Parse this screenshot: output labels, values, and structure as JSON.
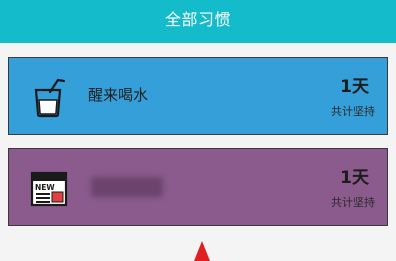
{
  "header": {
    "title": "全部习惯"
  },
  "habits": [
    {
      "name": "醒来喝水",
      "icon": "glass-of-water-icon",
      "days": "1天",
      "days_label": "共计坚持",
      "color": "#349fd8"
    },
    {
      "name": "",
      "icon": "news-icon",
      "icon_label": "NEW",
      "days": "1天",
      "days_label": "共计坚持",
      "color": "#8b5b8e"
    }
  ],
  "colors": {
    "header": "#14bccb",
    "background": "#f4f4f4",
    "arrow": "#e02020"
  }
}
